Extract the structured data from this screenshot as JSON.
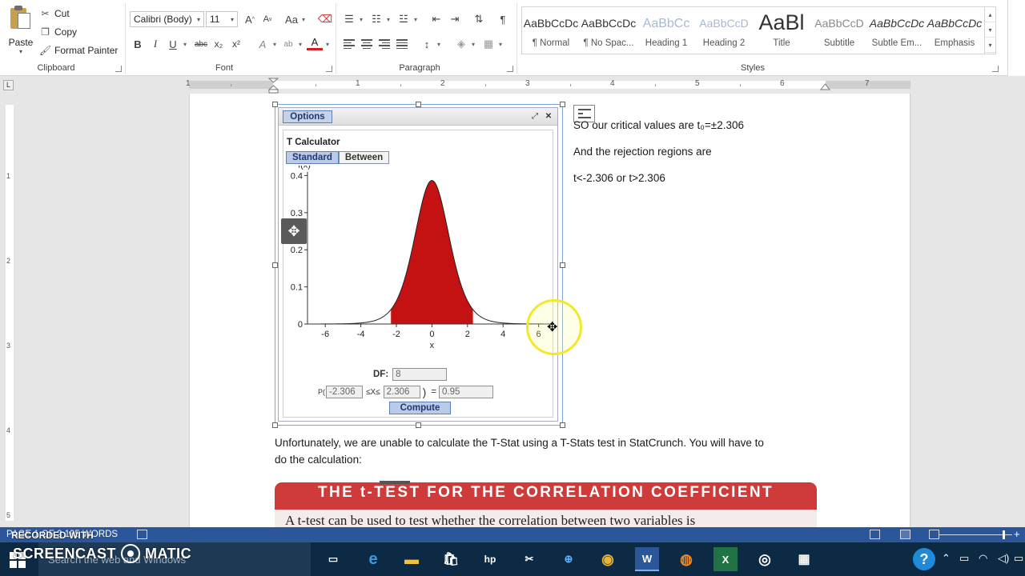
{
  "clipboard": {
    "paste_label": "Paste",
    "cut_label": "Cut",
    "copy_label": "Copy",
    "format_painter_label": "Format Painter",
    "group_label": "Clipboard"
  },
  "font": {
    "name": "Calibri (Body)",
    "size": "11",
    "group_label": "Font",
    "grow_label": "A",
    "shrink_label": "A",
    "case_label": "Aa",
    "bold_label": "B",
    "italic_label": "I",
    "underline_label": "U",
    "strike_label": "abc",
    "sub_label": "x₂",
    "sup_label": "x²",
    "effects_label": "A",
    "highlight_label": "ab",
    "color_label": "A"
  },
  "paragraph": {
    "group_label": "Paragraph",
    "show_marks_label": "¶"
  },
  "styles": {
    "group_label": "Styles",
    "items": [
      {
        "preview": "AaBbCcDc",
        "name": "¶ Normal"
      },
      {
        "preview": "AaBbCcDc",
        "name": "¶ No Spac..."
      },
      {
        "preview": "AaBbCc",
        "name": "Heading 1"
      },
      {
        "preview": "AaBbCcD",
        "name": "Heading 2"
      },
      {
        "preview": "AaBl",
        "name": "Title"
      },
      {
        "preview": "AaBbCcD",
        "name": "Subtitle"
      },
      {
        "preview": "AaBbCcDc",
        "name": "Subtle Em..."
      },
      {
        "preview": "AaBbCcDc",
        "name": "Emphasis"
      }
    ]
  },
  "ruler": {
    "numbers": [
      "1",
      "1",
      "2",
      "3",
      "4",
      "5",
      "6",
      "7"
    ],
    "vertical_numbers": [
      "1",
      "2",
      "3",
      "4",
      "5"
    ]
  },
  "document": {
    "line1": "SO our critical values are t₀=±2.306",
    "line2": "And the rejection regions are",
    "line3": "t<-2.306 or t>2.306",
    "para1": "Unfortunately, we are unable to calculate the T-Stat using a T-Stats test in StatCrunch.  You will have to",
    "para2": "do the calculation:",
    "banner_title": "THE t-TEST FOR THE CORRELATION COEFFICIENT",
    "banner_text": "A t-test can be used to test whether the correlation between two variables is"
  },
  "applet": {
    "options_label": "Options",
    "title": "T Calculator",
    "tab_standard": "Standard",
    "tab_between": "Between",
    "df_label": "DF:",
    "df_value": "8",
    "p_label": "P(",
    "lower_value": "-2.306",
    "le1": "≤X≤",
    "upper_value": "2.306",
    "close_paren": ")",
    "equals": "=",
    "prob_value": "0.95",
    "compute_label": "Compute"
  },
  "chart_data": {
    "type": "area",
    "title": "",
    "xlabel": "x",
    "ylabel": "f(x)",
    "xlim": [
      -7,
      7
    ],
    "ylim": [
      0,
      0.4
    ],
    "xticks": [
      -6,
      -4,
      -2,
      0,
      2,
      4,
      6
    ],
    "yticks": [
      0,
      0.1,
      0.2,
      0.3,
      0.4
    ],
    "distribution": "t",
    "df": 8,
    "shaded_interval": [
      -2.306,
      2.306
    ],
    "shaded_probability": 0.95,
    "colors": {
      "fill": "#c41212",
      "curve": "#222222"
    }
  },
  "statusbar": {
    "text": "PAGE 1 OF 2   195 WORDS",
    "zoom_minus": "−",
    "zoom_plus": "+"
  },
  "taskbar": {
    "search_placeholder": "Search the web and Windows",
    "recorded_with": "RECORDED WITH",
    "logo_left": "SCREENCAST",
    "logo_right": "MATIC",
    "word_label": "W",
    "excel_label": "X"
  }
}
